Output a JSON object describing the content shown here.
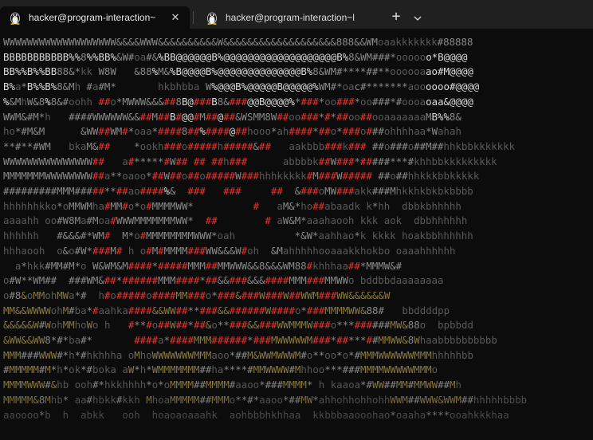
{
  "tabs": [
    {
      "label": "hacker@program-interaction~",
      "icon": "linux-penguin-icon",
      "active": true
    },
    {
      "label": "hacker@program-interaction~l",
      "icon": "linux-penguin-icon",
      "active": false
    }
  ],
  "toolbar": {
    "new_tab": "+",
    "dropdown": "⌄"
  },
  "terminal": {
    "lines": [
      "WWWWWWWWWWWWWWWWWWW&&&&WWW&&&&&&&&&&W&&&&&&&&&&&&&&&&&&&888&&WMoaakkkkkkk#88888",
      "BBBBBBBBBBB%%8%%BB%&W#oa#&%BB@@@@@@B%@@@@@@@@@@@@@@@@@@@B%8&WM###*oooooo*B@@@@",
      "BB%%B%%BB88&*kk W8W   &88%M&%B@@@@B%@@@@@@@@@@@@@@B%8&WM#****##**oooooaao#M@@@@",
      "B%a*B%%B%8&Mh #a#M*       hkbhbba W%@@@B%@@@@@B@@@@@%WM#*oac#*******aoooooo#@@@@",
      "%&MhW&8%8&#oohh ##o*MWWW&&&##8B@###B8&###@@B@@@@%*###*oo###*oo###*#oooaoaa&@@@@",
      "WWM&#M*h   ####WWWWWW&&##M##B#@@#M##@##&WSMM8W##oo###*#*##oo##ooaaaaaaaMB%%8&",
      "ho*#M&M      &WW##WM#*oaa*####8##%####@##hooo*ah####*##o*###o###ohhhhaa*Wahah",
      "**#**#WM   bkaM&##    *ookh###o#####h#####&##   aakbbb###k### ##o###o##M##hhkbbkkkkkkk",
      "WWWWWWWWWWWWWWW##   a#*****#W## ## ##h###      abbbbk##W###*#####***#khhbbkkkkkkkkk",
      "MMMMMMMWWWWWWWW##a**oaoo*##W##o##o#####W###hhhkkkkk#M###W##### ##o##hhkkkbbkkkkk",
      "#########MMM#####**##ao####%&  ###   ###     ##  &###oMW###akk###Mhkkhkbkbkbbbb",
      "hhhhhhkko*oMMWMha#MM#o*o#MMMMWW*          #   aM&*ho##abaadk k*hh  dbbkbhhhhh",
      "aaaahh oo#W8Ma#Moa#WWWMMMMMMMWW*  ##        # aW&M*aaahaooh kkk aok  dbbhhhhhh",
      "hhhhhh   #&&&#*WM#  M*o#MMMMMMMMWWW*oah          *&W*aahhao*k kkkk hoakbbhhhhhh",
      "hhhaooh  o&o#W*###M# h o#M#MMMM###WW&&&W#oh  &Mahhhhhooaaakkhokbo oaaahhhhhh",
      "  a*hkk#MM#M*o W&WM&M####*#####MMM##MMWWW&&8&&&WM88#khhhaa##*MMMW&#",
      "o#W**WM##  ###WM&##*######MMM####*##&&###&&&####MMM###MMWWo bddbbdaaaaaaaa",
      "o#8&oMMohMWa*#  h#o#####o####MM###o*###&###W###W##WWM###WW&&&&&&W",
      "MM&&WWWWohM#ba*#aahka####&&WW##**###&&######W####o*###MMMMWW&88#   bbddddpp",
      "&&&&&W#WohMMhoWo h   #**#o##W##*##&o**###&&###WWMMMW###o***######MW&88o  bpbbdd",
      "&WW&&WW8*#*ba#*       ####a*####MMM######*###MWWWWWM###*##***##MMWW&8Whaabbbbbbbbbb",
      "MMM###WWW#*h*#hkhhha oMhoWWWWWWWMMMaoo*##M&WWMWWWM#o**oo*o*#MMMWWWWWWMMMhhhhhbb",
      "#MMMMM#M*h*ok*#boka aW*h*WMMMMMMM##ha****#MMWWWW#Mhhoo***###MMMMWWWWWMMMo",
      "MMMMWWW#&hb ooh#*hkkhhhh*o*oMMMM##MMMM#aaoo*###MMMM* h kaaoa*#WW##MM#MMWW##Mh",
      "MMMMM&8Mhb* aa#hbkk#kkh MhoaMMMMM##MMMo**#*aaoo*##MW*ahhohhohhohhWWM##WWW&WWM##hhhhhbbbb",
      "aaoooo*b  h  abkk   ooh  hoaoaoaaahk  aohbbbhkhhaa  kkbbbaaooohao*oaaha****ooahkkkhaa"
    ]
  }
}
